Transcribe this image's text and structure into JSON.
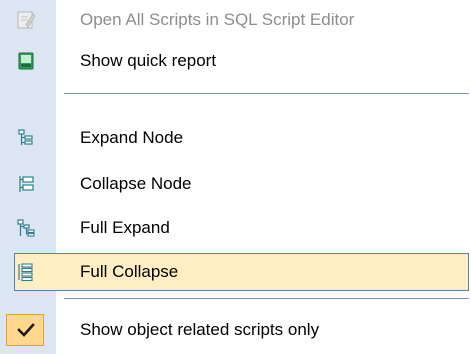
{
  "menu": {
    "items": [
      {
        "label": "Open All Scripts in SQL Script Editor",
        "icon": "script-editor-icon",
        "enabled": false
      },
      {
        "label": "Show quick report",
        "icon": "report-icon",
        "enabled": true
      },
      {
        "label": "Expand Node",
        "icon": "tree-expand-node-icon",
        "enabled": true
      },
      {
        "label": "Collapse Node",
        "icon": "tree-collapse-node-icon",
        "enabled": true
      },
      {
        "label": "Full Expand",
        "icon": "tree-full-expand-icon",
        "enabled": true
      },
      {
        "label": "Full Collapse",
        "icon": "tree-full-collapse-icon",
        "enabled": true,
        "highlighted": true
      },
      {
        "label": "Show object related scripts only",
        "icon": "checkmark-icon",
        "enabled": true,
        "checked": true
      }
    ]
  },
  "colors": {
    "gutter": "#dbe6f2",
    "highlight_fill": "#ffeec2",
    "highlight_border": "#4f80bd",
    "separator": "#6e96c9",
    "disabled_text": "#8d8d8d",
    "check_fill": "#ffd88e"
  }
}
